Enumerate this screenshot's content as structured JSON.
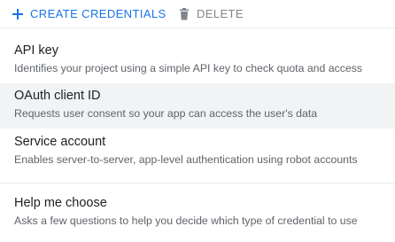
{
  "toolbar": {
    "create_label": "CREATE CREDENTIALS",
    "delete_label": "DELETE",
    "create_icon": "plus-icon",
    "delete_icon": "trash-icon"
  },
  "menu": {
    "items": [
      {
        "title": "API key",
        "description": "Identifies your project using a simple API key to check quota and access"
      },
      {
        "title": "OAuth client ID",
        "description": "Requests user consent so your app can access the user's data",
        "highlighted": true
      },
      {
        "title": "Service account",
        "description": "Enables server-to-server, app-level authentication using robot accounts"
      },
      {
        "title": "Help me choose",
        "description": "Asks a few questions to help you decide which type of credential to use"
      }
    ]
  },
  "colors": {
    "accent": "#1a73e8",
    "disabled": "#80868b",
    "highlight_bg": "#f1f3f4",
    "title_text": "#202124",
    "desc_text": "#5f6368"
  }
}
